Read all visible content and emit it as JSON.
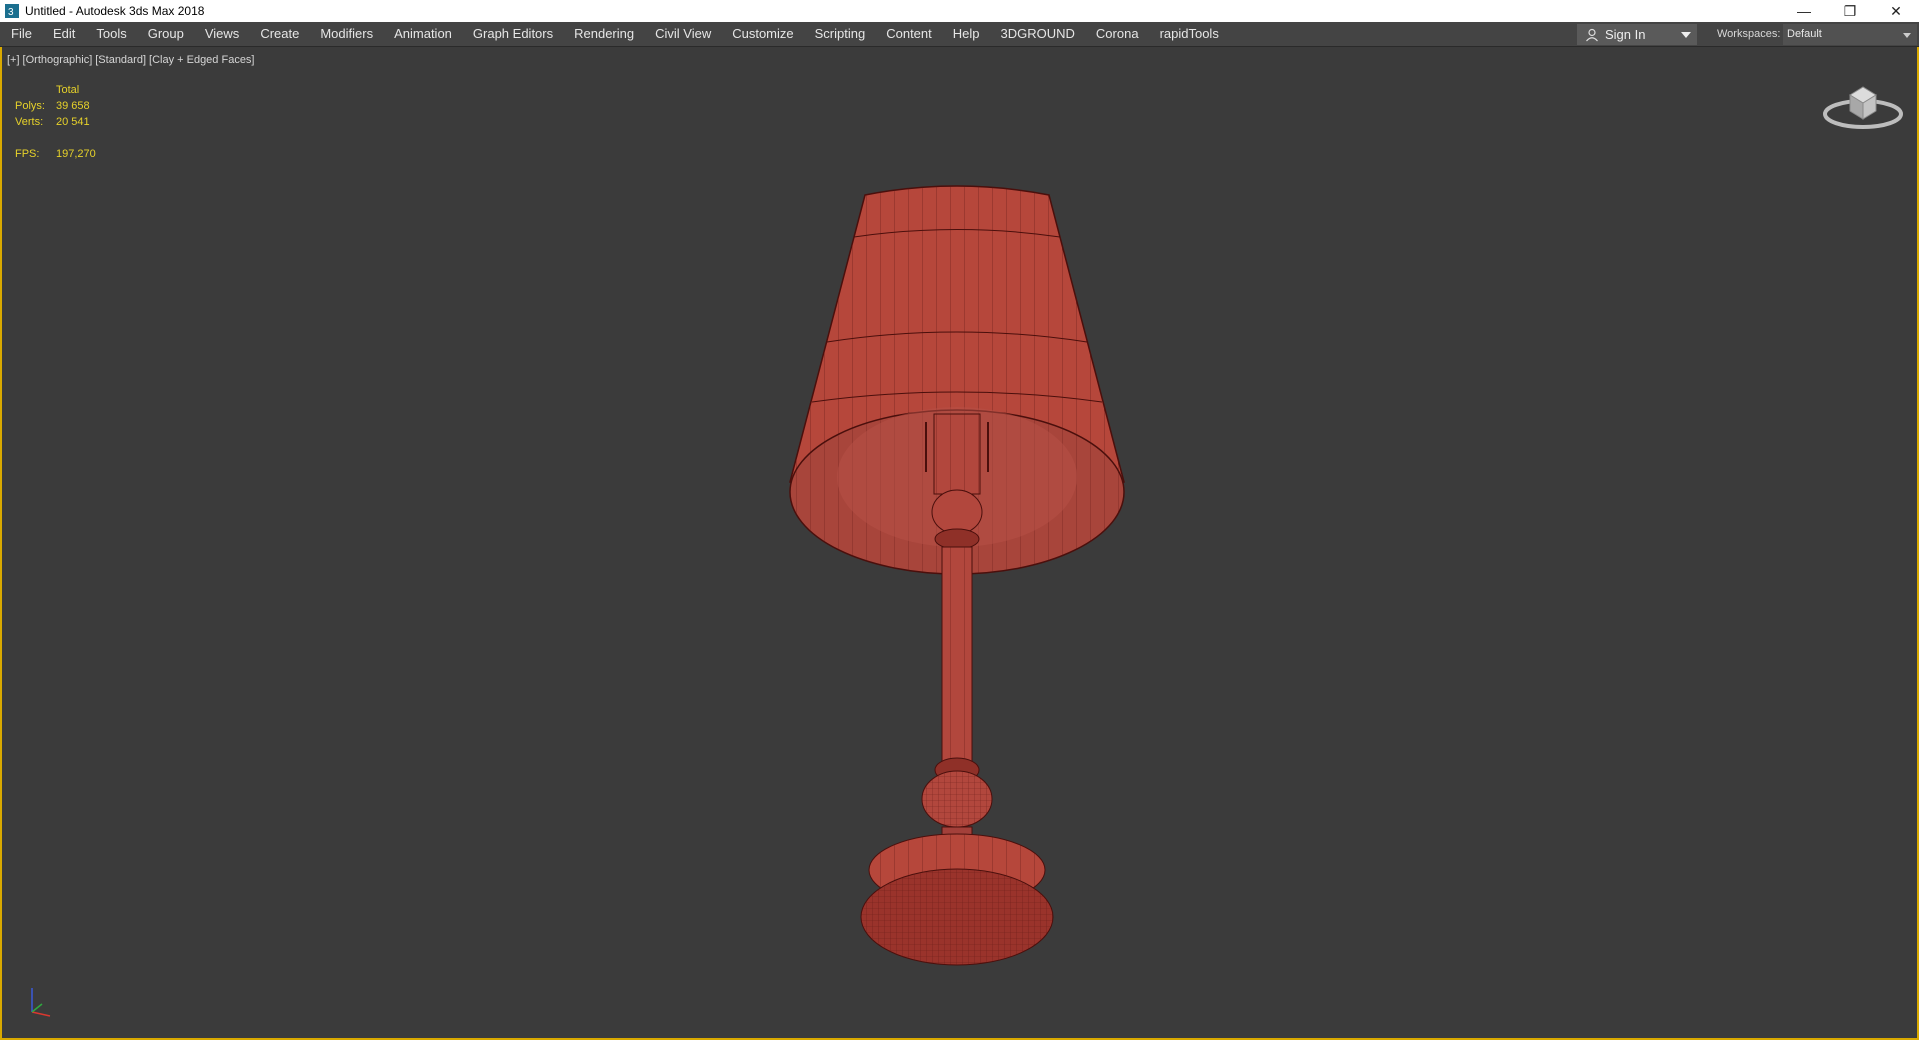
{
  "window": {
    "title": "Untitled - Autodesk 3ds Max 2018",
    "controls": [
      "minimize-icon",
      "restore-icon",
      "close-icon"
    ]
  },
  "menu": {
    "items": [
      "File",
      "Edit",
      "Tools",
      "Group",
      "Views",
      "Create",
      "Modifiers",
      "Animation",
      "Graph Editors",
      "Rendering",
      "Civil View",
      "Customize",
      "Scripting",
      "Content",
      "Help",
      "3DGROUND",
      "Corona",
      "rapidTools"
    ]
  },
  "signin": {
    "label": "Sign In"
  },
  "workspaces": {
    "label": "Workspaces:",
    "value": "Default"
  },
  "viewport": {
    "labels": [
      "[+]",
      "[Orthographic]",
      "[Standard]",
      "[Clay + Edged Faces]"
    ],
    "stats": {
      "header": "Total",
      "polys_label": "Polys:",
      "polys": "39 658",
      "verts_label": "Verts:",
      "verts": "20 541",
      "fps_label": "FPS:",
      "fps": "197,270"
    }
  },
  "colors": {
    "accent": "#d9a900",
    "stats_text": "#e7d22a",
    "model": "#b94a3f"
  }
}
